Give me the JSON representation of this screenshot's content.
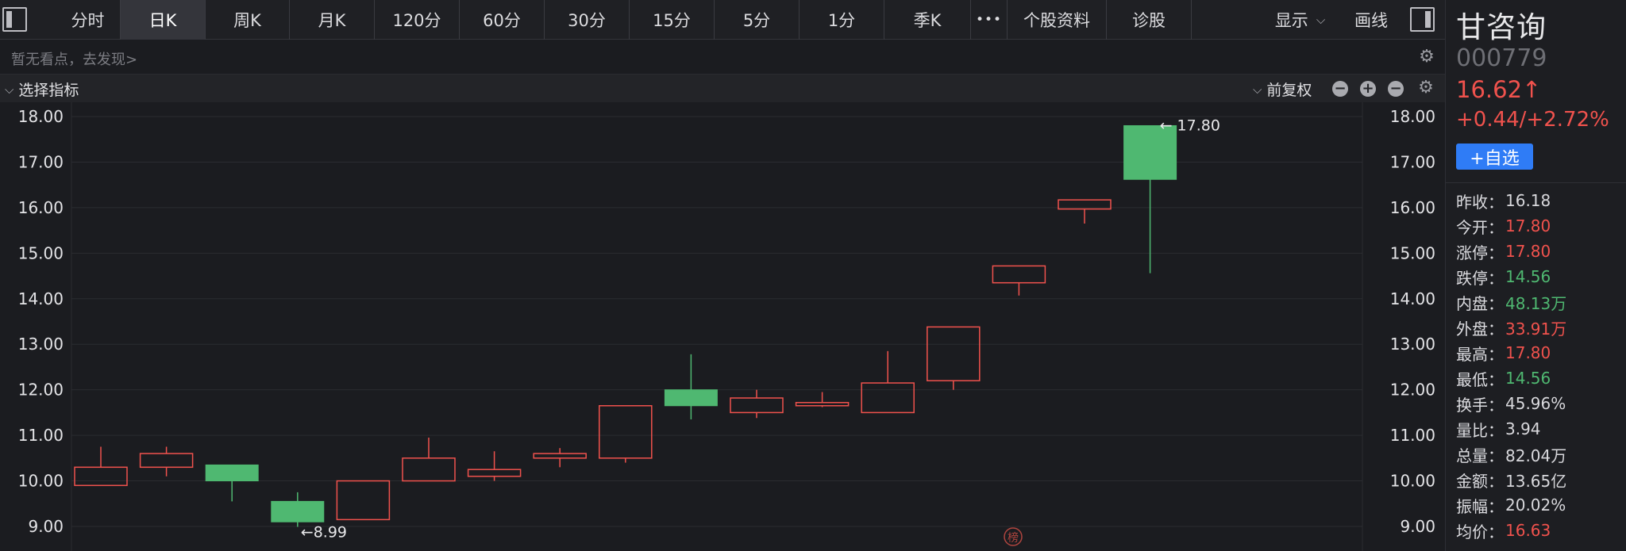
{
  "toolbar": {
    "tabs": [
      {
        "label": "分时",
        "active": false
      },
      {
        "label": "日K",
        "active": true
      },
      {
        "label": "周K",
        "active": false
      },
      {
        "label": "月K",
        "active": false
      },
      {
        "label": "120分",
        "active": false
      },
      {
        "label": "60分",
        "active": false
      },
      {
        "label": "30分",
        "active": false
      },
      {
        "label": "15分",
        "active": false
      },
      {
        "label": "5分",
        "active": false
      },
      {
        "label": "1分",
        "active": false
      },
      {
        "label": "季K",
        "active": false
      }
    ],
    "more": "•••",
    "profile": "个股资料",
    "diagnose": "诊股",
    "display": "显示",
    "draw": "画线"
  },
  "hint": {
    "text": "暂无看点，去发现>"
  },
  "indicator": {
    "select_label": "选择指标",
    "adjust_label": "前复权",
    "icons": [
      "minus-icon",
      "plus-icon",
      "minus-icon",
      "gear-icon"
    ]
  },
  "stock": {
    "name": "甘咨询",
    "code": "000779",
    "price": "16.62",
    "price_arrow": "↑",
    "change": "+0.44/+2.72%",
    "add_watch": "+自选"
  },
  "quote": [
    {
      "label": "昨收",
      "value": "16.18",
      "color": "#d8d8dc"
    },
    {
      "label": "今开",
      "value": "17.80",
      "color": "#f0524d"
    },
    {
      "label": "涨停",
      "value": "17.80",
      "color": "#f0524d"
    },
    {
      "label": "跌停",
      "value": "14.56",
      "color": "#4fb871"
    },
    {
      "label": "内盘",
      "value": "48.13万",
      "color": "#4fb871"
    },
    {
      "label": "外盘",
      "value": "33.91万",
      "color": "#f0524d"
    },
    {
      "label": "最高",
      "value": "17.80",
      "color": "#f0524d"
    },
    {
      "label": "最低",
      "value": "14.56",
      "color": "#4fb871"
    },
    {
      "label": "换手",
      "value": "45.96%",
      "color": "#d8d8dc"
    },
    {
      "label": "量比",
      "value": "3.94",
      "color": "#d8d8dc"
    },
    {
      "label": "总量",
      "value": "82.04万",
      "color": "#d8d8dc"
    },
    {
      "label": "金额",
      "value": "13.65亿",
      "color": "#d8d8dc"
    },
    {
      "label": "振幅",
      "value": "20.02%",
      "color": "#d8d8dc"
    },
    {
      "label": "均价",
      "value": "16.63",
      "color": "#f0524d"
    }
  ],
  "colors": {
    "up": "#f0524d",
    "down": "#4fb871",
    "grid": "#2b2c31",
    "axis_text": "#e4e4e7"
  },
  "chart_data": {
    "type": "candlestick",
    "ylim": [
      9.0,
      18.0
    ],
    "y_ticks": [
      "9.00",
      "10.00",
      "11.00",
      "12.00",
      "13.00",
      "14.00",
      "15.00",
      "16.00",
      "17.00",
      "18.00"
    ],
    "candles": [
      {
        "open": 9.9,
        "close": 10.3,
        "high": 10.75,
        "low": 9.9
      },
      {
        "open": 10.3,
        "close": 10.6,
        "high": 10.75,
        "low": 10.1
      },
      {
        "open": 10.35,
        "close": 10.0,
        "high": 10.35,
        "low": 9.55
      },
      {
        "open": 9.55,
        "close": 9.1,
        "high": 9.75,
        "low": 8.99
      },
      {
        "open": 9.15,
        "close": 10.0,
        "high": 10.0,
        "low": 9.15
      },
      {
        "open": 10.0,
        "close": 10.5,
        "high": 10.95,
        "low": 10.0
      },
      {
        "open": 10.1,
        "close": 10.25,
        "high": 10.65,
        "low": 10.0
      },
      {
        "open": 10.5,
        "close": 10.6,
        "high": 10.72,
        "low": 10.3
      },
      {
        "open": 10.5,
        "close": 11.65,
        "high": 11.65,
        "low": 10.4
      },
      {
        "open": 12.0,
        "close": 11.65,
        "high": 12.78,
        "low": 11.35
      },
      {
        "open": 11.5,
        "close": 11.82,
        "high": 12.0,
        "low": 11.38
      },
      {
        "open": 11.65,
        "close": 11.72,
        "high": 11.95,
        "low": 11.62
      },
      {
        "open": 11.5,
        "close": 12.15,
        "high": 12.85,
        "low": 11.5
      },
      {
        "open": 12.2,
        "close": 13.38,
        "high": 13.38,
        "low": 12.0
      },
      {
        "open": 14.35,
        "close": 14.72,
        "high": 14.72,
        "low": 14.07
      },
      {
        "open": 15.97,
        "close": 16.17,
        "high": 16.17,
        "low": 15.65
      },
      {
        "open": 17.8,
        "close": 16.62,
        "high": 17.8,
        "low": 14.56
      }
    ],
    "annotations": [
      {
        "text": "←8.99",
        "candle": 3,
        "value": 8.99,
        "side": "right"
      },
      {
        "text": "← 17.80",
        "candle": 16,
        "value": 17.8,
        "side": "left"
      }
    ],
    "watermark": "榜"
  }
}
